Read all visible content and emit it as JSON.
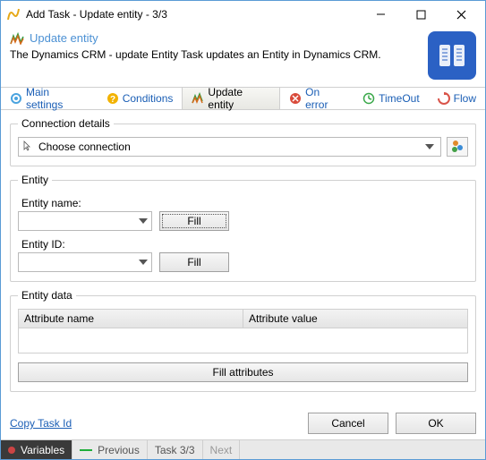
{
  "window": {
    "title": "Add Task - Update entity - 3/3"
  },
  "page": {
    "title": "Update entity",
    "description": "The Dynamics CRM - update Entity Task updates an Entity in Dynamics CRM."
  },
  "tabs": {
    "main": "Main settings",
    "conditions": "Conditions",
    "update": "Update entity",
    "onerror": "On error",
    "timeout": "TimeOut",
    "flow": "Flow"
  },
  "conn": {
    "legend": "Connection details",
    "placeholder": "Choose connection"
  },
  "entity": {
    "legend": "Entity",
    "name_label": "Entity name:",
    "id_label": "Entity ID:",
    "name_value": "",
    "id_value": "",
    "fill": "Fill"
  },
  "data": {
    "legend": "Entity data",
    "col_attr": "Attribute name",
    "col_val": "Attribute value",
    "fill_attrs": "Fill attributes"
  },
  "footer": {
    "copy": "Copy Task Id",
    "cancel": "Cancel",
    "ok": "OK"
  },
  "status": {
    "variables": "Variables",
    "previous": "Previous",
    "task": "Task 3/3",
    "next": "Next"
  }
}
